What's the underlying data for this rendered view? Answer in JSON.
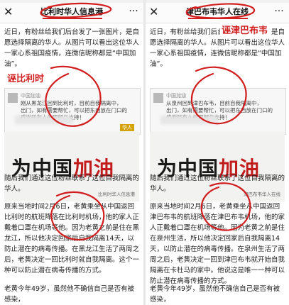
{
  "left": {
    "nav_title": "比利时华人信息港",
    "close_icon": "✕",
    "more_icon": "···",
    "paragraph1": "近日，有粉丝给我们后台发了一张图片，是自愿选择隔离的华人。从图片可以看出这位华人一家心系祖国疫情，连微信昵称都是“中国加油”。",
    "card_name": "中国加油",
    "card_lines": [
      "刚从黑龙江回到比利时，目前自我隔离中，",
      "出门，如有需要帮忙，可以把东西放在门口的",
      "感谢所有人的理解与支持！"
    ],
    "card_tag": "华人",
    "calligraphy": [
      "为中国",
      "加油"
    ],
    "watermark": "比利时华人信息港",
    "paragraph2": "随后我们通过这位粉丝联系了这位自我隔离的华人。",
    "paragraph3": "原来当地时间2月6日，老黄乘坐从中国返回比利时的航班降落在比利时机场，他的家人正戴着口罩在机场等他。因为老黄之前是住在黑龙江，所以他决定回家后自我隔离14天，以防止潜在的病毒传播。在黑龙江生活了两周之后，老黄决定一回比利时就自我隔离。这个一种可以防止潜在病毒传播的方式。",
    "paragraph4": "老黄今年49岁，虽然他不确信自己是否有被感染，",
    "annotation": "诬比利时"
  },
  "right": {
    "nav_title": "津巴布韦华人在线",
    "close_icon": "✕",
    "more_icon": "···",
    "paragraph1": "近日，有粉丝给我们后台发了一张图片，是自愿选择隔离的华人。从图片可以看出这位华人一家心系祖国疫情，连微信昵称都是“中国加油”。",
    "card_name": "中国加油",
    "card_lines": [
      "从泉州回到津巴布韦，目前自我隔离中，",
      "出门，如有需要帮忙，可以把东西放在门口的",
      "感谢所有人的理解与支持！"
    ],
    "calligraphy": [
      "为中国",
      "加油"
    ],
    "watermark": "津巴布韦华人在线",
    "paragraph2": "随后我们通过这位粉丝联系了这位自我隔离的华人。",
    "paragraph3": "原来当地时间2月6日，老黄乘坐从中国返回津巴布韦的航班降落在津巴布韦机场，他的家人正戴着口罩在机场等他。因为老黄之前是住在泉州生活，所以他决定回家后自我隔离14天，以防止潜在的病毒传播。在泉州生活了两周之后，老黄决定一回到津巴布韦就开始自我隔离在卡杜马的家中。他说这是唯一一种可以防止潜在病毒传播的方式。",
    "paragraph4": "老黄今年49岁，虽然他不确信自己是否有被感染，",
    "annotation": "诬津巴布韦"
  },
  "colors": {
    "accent_red": "#d11d1d",
    "text": "#222222",
    "card_bg": "#f7f7f7",
    "divider": "#e6e6e6"
  }
}
